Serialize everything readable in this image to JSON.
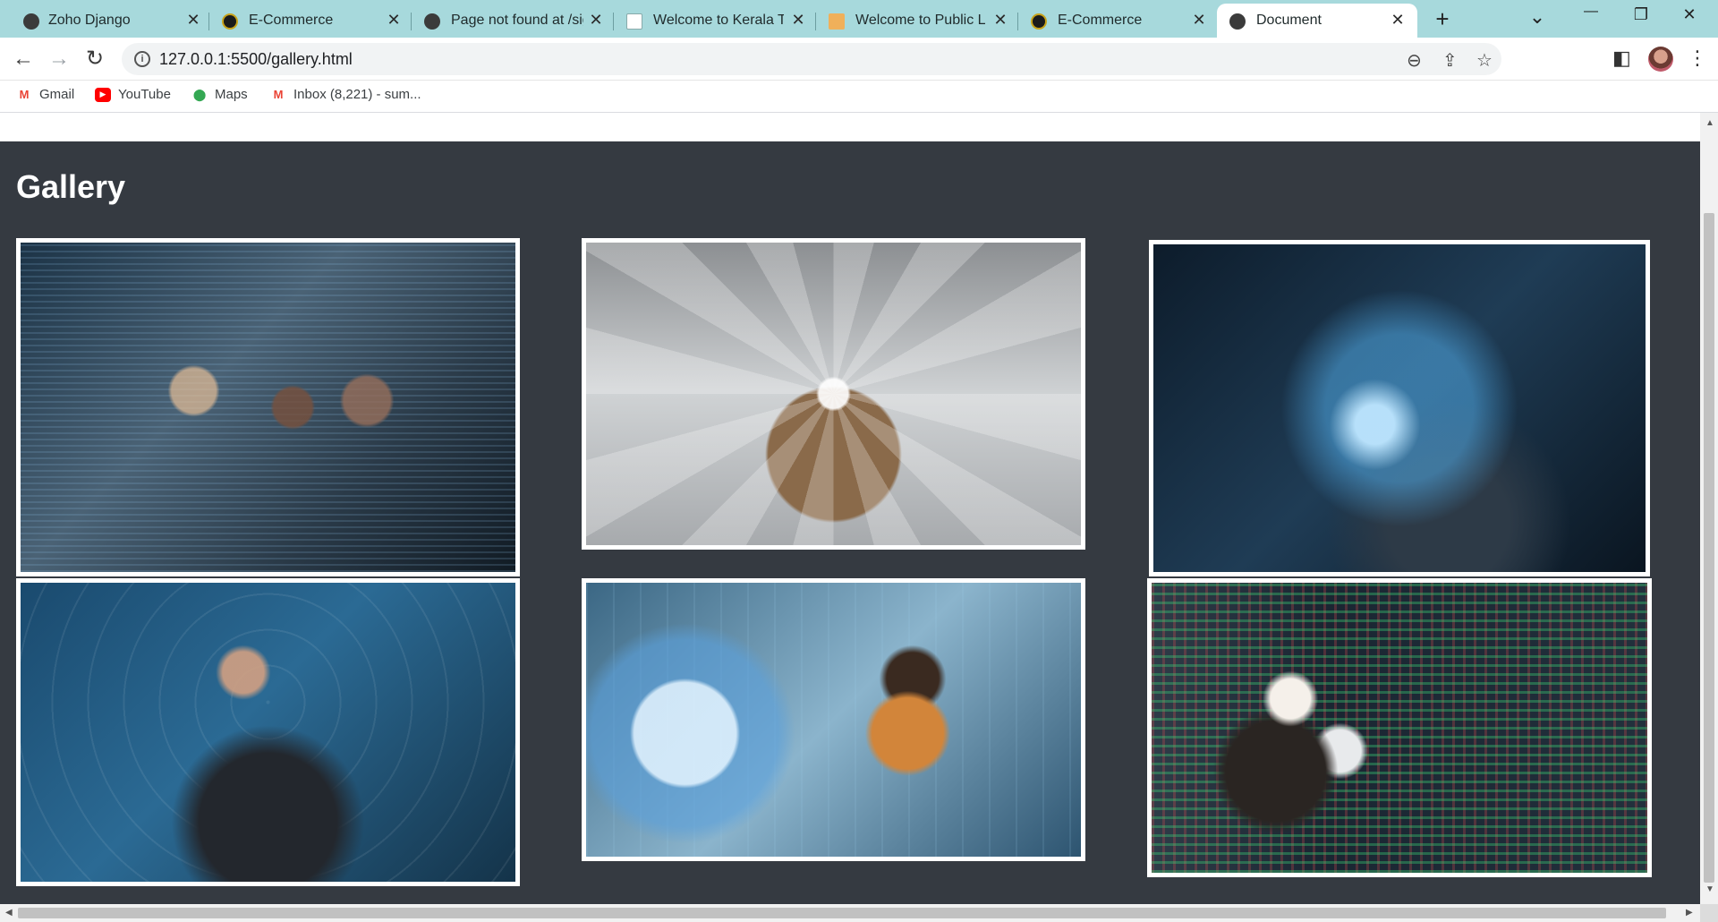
{
  "tabs": [
    {
      "label": "Zoho Django",
      "favicon": "globe-icon"
    },
    {
      "label": "E-Commerce",
      "favicon": "ecommerce-logo-icon"
    },
    {
      "label": "Page not found at /sig",
      "favicon": "globe-icon"
    },
    {
      "label": "Welcome to Kerala Tou",
      "favicon": "page-icon"
    },
    {
      "label": "Welcome to Public Libr",
      "favicon": "book-icon"
    },
    {
      "label": "E-Commerce",
      "favicon": "ecommerce-logo-icon"
    },
    {
      "label": "Document",
      "favicon": "globe-icon",
      "active": true
    }
  ],
  "tab_close_glyph": "✕",
  "new_tab_glyph": "+",
  "window_controls": {
    "tab_search": "⌄",
    "minimize": "—",
    "maximize": "❐",
    "close": "✕"
  },
  "toolbar": {
    "back": "←",
    "forward": "→",
    "reload": "↻",
    "url": "127.0.0.1:5500/gallery.html",
    "info_glyph": "i",
    "zoom_glyph": "⊖",
    "share_glyph": "⇪",
    "star_glyph": "☆",
    "sidepanel_glyph": "◧",
    "menu_glyph": "⋮"
  },
  "bookmarks": [
    {
      "label": "Gmail",
      "icon": "gmail-icon",
      "glyph": "M"
    },
    {
      "label": "YouTube",
      "icon": "youtube-icon",
      "glyph": "▶"
    },
    {
      "label": "Maps",
      "icon": "maps-icon",
      "glyph": "⬤"
    },
    {
      "label": "Inbox (8,221) - sum...",
      "icon": "gmail-icon",
      "glyph": "M"
    }
  ],
  "page": {
    "title": "Gallery",
    "images": [
      {
        "name": "team-coding-image"
      },
      {
        "name": "iot-bigdata-image"
      },
      {
        "name": "floating-devices-image"
      },
      {
        "name": "cloud-network-image"
      },
      {
        "name": "globe-hologram-image"
      },
      {
        "name": "server-room-image"
      }
    ]
  },
  "colors": {
    "tabstrip": "#a7d9dc",
    "page_background": "#353a41",
    "card_border": "#ffffff"
  }
}
